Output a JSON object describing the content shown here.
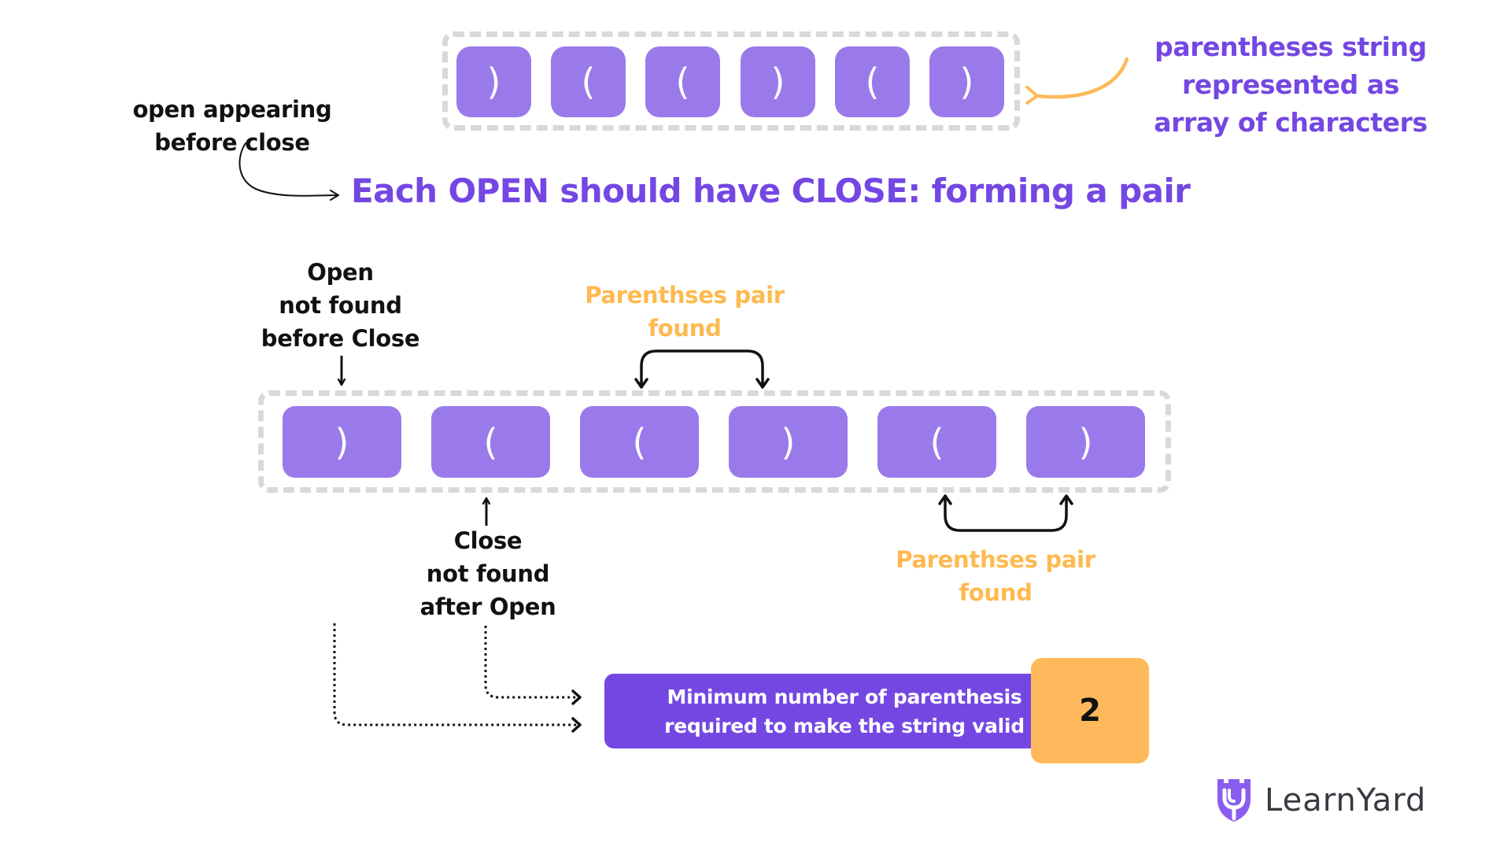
{
  "top_array": {
    "cells": [
      ")",
      "(",
      "(",
      ")",
      "(",
      ")"
    ],
    "caption_lines": [
      "parentheses string",
      "represented as",
      "array of characters"
    ]
  },
  "side_note": {
    "lines": [
      "open appearing",
      "before close"
    ]
  },
  "headline": "Each OPEN should have CLOSE: forming a pair",
  "bottom_array": {
    "cells": [
      ")",
      "(",
      "(",
      ")",
      "(",
      ")"
    ]
  },
  "annotations": {
    "open_not_found": [
      "Open",
      "not found",
      "before Close"
    ],
    "close_not_found": [
      "Close",
      "not found",
      "after Open"
    ],
    "pair_found_top": [
      "Parenthses pair",
      "found"
    ],
    "pair_found_bottom": [
      "Parenthses pair",
      "found"
    ]
  },
  "result": {
    "label_lines": [
      "Minimum number of parenthesis",
      "required to make the string valid"
    ],
    "value": "2"
  },
  "brand": {
    "name": "LearnYard",
    "logo_icon": "shield-logo-icon"
  },
  "colors": {
    "cell": "#9a7aea",
    "accent_purple": "#7447e3",
    "accent_orange": "#fdb95b",
    "dash_border": "#d9d9d9"
  }
}
